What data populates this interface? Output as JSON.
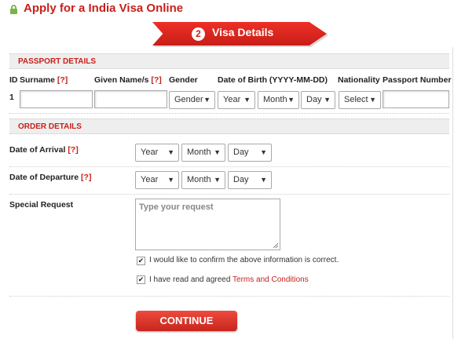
{
  "header": {
    "title": "Apply for a India Visa Online",
    "step_number": "2",
    "step_label": "Visa Details"
  },
  "passport": {
    "section_title": "PASSPORT DETAILS",
    "col_id": "ID",
    "col_surname": "Surname",
    "col_given": "Given Name/s",
    "col_gender": "Gender",
    "col_dob": "Date of Birth (YYYY-MM-DD)",
    "col_nationality": "Nationality",
    "col_passport": "Passport Number",
    "help": "[?]",
    "row_id": "1",
    "gender_value": "Gender",
    "dob_year": "Year",
    "dob_month": "Month",
    "dob_day": "Day",
    "nationality_value": "Select"
  },
  "order": {
    "section_title": "ORDER DETAILS",
    "arrival_label": "Date of Arrival",
    "departure_label": "Date of Departure",
    "help": "[?]",
    "year": "Year",
    "month": "Month",
    "day": "Day",
    "special_label": "Special Request",
    "special_placeholder": "Type your request",
    "confirm_text": "I would like to confirm the above information is correct.",
    "agree_text": "I have read and agreed ",
    "terms_link": "Terms and Conditions",
    "confirm_checked": true,
    "agree_checked": true
  },
  "actions": {
    "continue_label": "CONTINUE"
  },
  "colors": {
    "accent": "#c8201a",
    "section_bg": "#eeeeee"
  },
  "icons": {
    "lock": "lock-icon",
    "dropdown": "chevron-down-icon",
    "check": "checkmark-icon"
  }
}
